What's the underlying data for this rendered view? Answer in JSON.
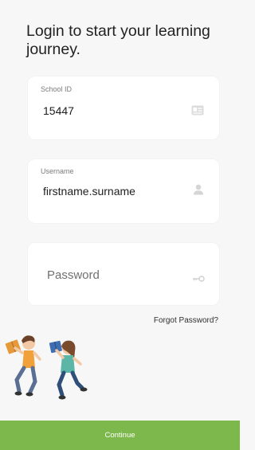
{
  "heading": "Login to start your learning journey.",
  "school": {
    "label": "School ID",
    "value": "15447",
    "icon": "id-card-icon"
  },
  "username": {
    "label": "Username",
    "value": "firstname.surname",
    "icon": "user-icon"
  },
  "password": {
    "placeholder": "Password",
    "icon": "key-icon"
  },
  "forgot_label": "Forgot Password?",
  "continue_label": "Continue",
  "colors": {
    "accent": "#7cb84b",
    "background": "#f7f7f7",
    "card": "#ffffff"
  }
}
